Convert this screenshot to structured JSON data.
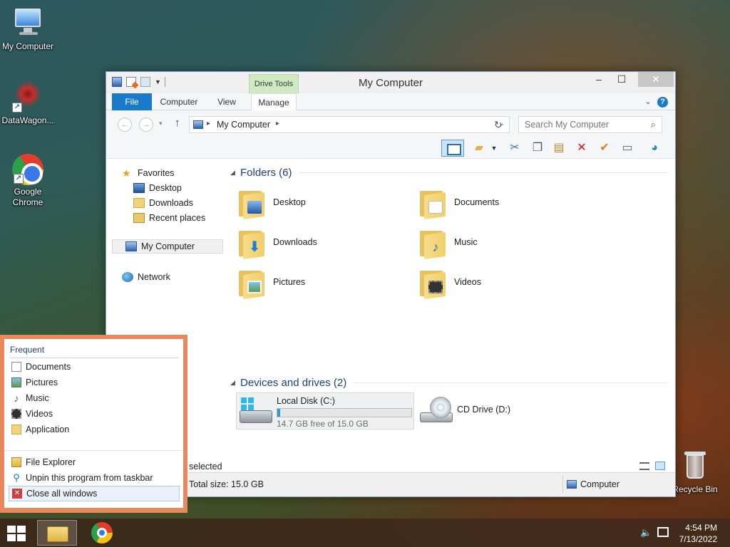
{
  "desktop": {
    "icons": [
      {
        "label": "My Computer",
        "icon": "computer-icon"
      },
      {
        "label": "DataWagon...",
        "icon": "datawagon-icon"
      },
      {
        "label": "Google Chrome",
        "icon": "chrome-icon"
      },
      {
        "label": "Recycle Bin",
        "icon": "recycle-bin-icon"
      }
    ]
  },
  "window": {
    "title": "My Computer",
    "context_tab_group": "Drive Tools",
    "ribbon_tabs": [
      "File",
      "Computer",
      "View",
      "Manage"
    ],
    "address": {
      "crumb": "My Computer"
    },
    "search": {
      "placeholder": "Search My Computer"
    },
    "nav": {
      "favorites": "Favorites",
      "favorites_items": [
        "Desktop",
        "Downloads",
        "Recent places"
      ],
      "my_computer": "My Computer",
      "network": "Network"
    },
    "folders_group": "Folders (6)",
    "folders": [
      {
        "label": "Desktop",
        "icon": "desktop-folder-icon"
      },
      {
        "label": "Documents",
        "icon": "documents-folder-icon"
      },
      {
        "label": "Downloads",
        "icon": "downloads-folder-icon"
      },
      {
        "label": "Music",
        "icon": "music-folder-icon"
      },
      {
        "label": "Pictures",
        "icon": "pictures-folder-icon"
      },
      {
        "label": "Videos",
        "icon": "videos-folder-icon"
      }
    ],
    "devices_group": "Devices and drives (2)",
    "drives": [
      {
        "label": "Local Disk (C:)",
        "free_text": "14.7 GB free of 15.0 GB",
        "used_fraction": 0.02,
        "icon": "hard-drive-icon"
      },
      {
        "label": "CD Drive (D:)",
        "icon": "cd-drive-icon"
      }
    ],
    "selection_text": "selected",
    "status": {
      "total_size": "Total size: 15.0 GB",
      "location": "Computer"
    }
  },
  "jumplist": {
    "frequent_header": "Frequent",
    "frequent": [
      "Documents",
      "Pictures",
      "Music",
      "Videos",
      "Application"
    ],
    "tasks": [
      "File Explorer",
      "Unpin this program from taskbar",
      "Close all windows"
    ]
  },
  "taskbar": {
    "time": "4:54 PM",
    "date": "7/13/2022"
  }
}
